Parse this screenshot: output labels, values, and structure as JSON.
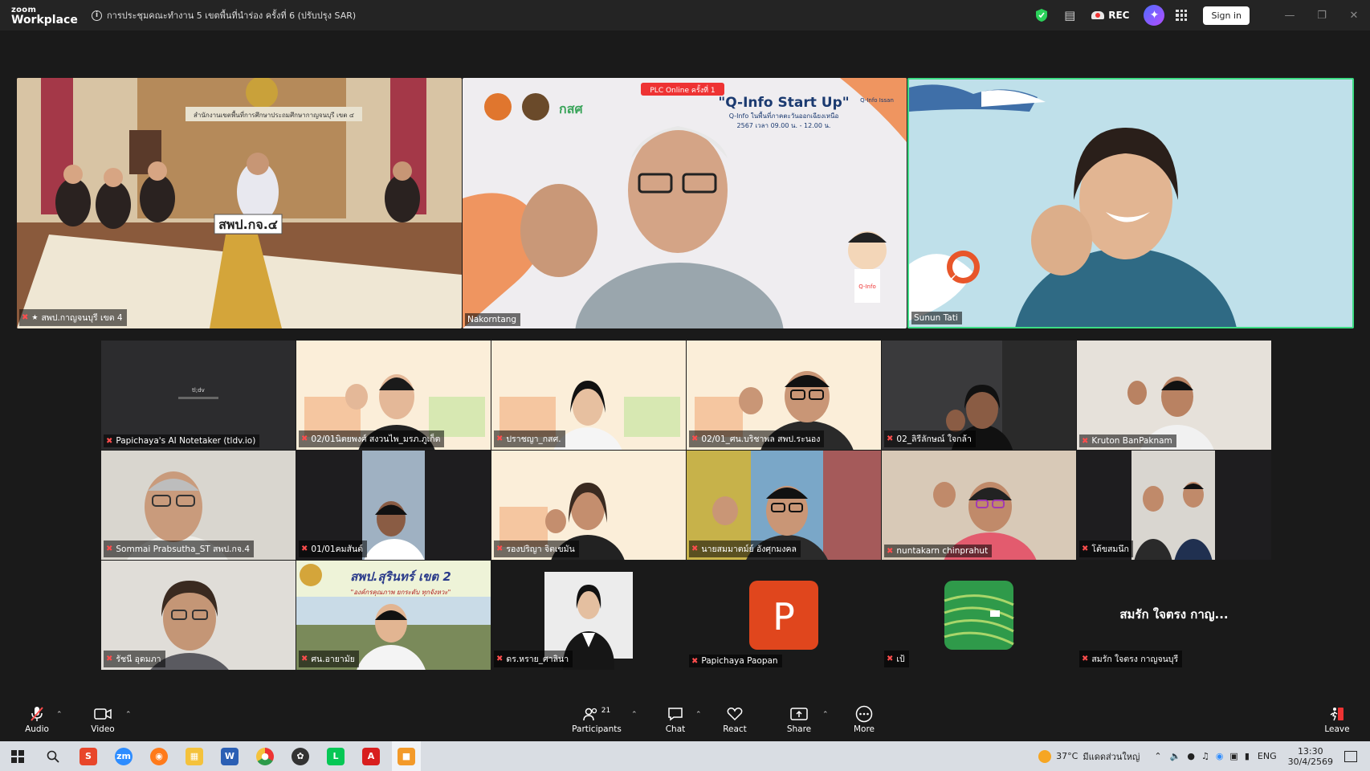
{
  "app": {
    "logo_line1": "zoom",
    "logo_line2": "Workplace",
    "meeting_title": "การประชุมคณะทำงาน 5 เขตพื้นที่นำร่อง ครั้งที่ 6 (ปรับปรุง SAR)",
    "rec_label": "REC",
    "sign_in_label": "Sign in"
  },
  "featured": [
    {
      "name": "สพป.กาญจนบุรี เขต 4",
      "sign": "สพป.กจ.๔",
      "banner": "สำนักงานเขตพื้นที่การศึกษาประถมศึกษากาญจนบุรี เขต ๔"
    },
    {
      "name": "Nakorntang",
      "slide_title": "\"Q-Info Start Up\"",
      "slide_sub": "Q-Info ในพื้นที่ภาคตะวันออกเฉียงเหนือ",
      "slide_time": "2567 เวลา 09.00 น. - 12.00 น.",
      "badge": "PLC Online ครั้งที่ 1",
      "brand": "กสศ",
      "qinfo_logo": "Q-Info Issan",
      "mascot_label": "Q-Info"
    },
    {
      "name": "Sunun Tati",
      "logo_letter": "Q"
    }
  ],
  "grid": [
    {
      "name": "Papichaya's AI Notetaker (tldv.io)",
      "logo": "tl;dv"
    },
    {
      "name": "02/01นิตยพงศ์ สงวนไพ_มรภ.ภูเก็ต"
    },
    {
      "name": "ปราชญา_กสศ."
    },
    {
      "name": "02/01_ศน.บริชาพล สพป.ระนอง"
    },
    {
      "name": "02_ลิรีลักษณ์ ใจกล้า"
    },
    {
      "name": "Kruton BanPaknam"
    },
    {
      "name": "Sommai Prabsutha_ST สพป.กจ.4"
    },
    {
      "name": "01/01คมสันต์"
    },
    {
      "name": "รองปริญา จิตเขมัน"
    },
    {
      "name": "นายสมมาตม์ย์ อังศุกมงคล"
    },
    {
      "name": "nuntakarn chinprahut"
    },
    {
      "name": "โต้ขสมนึก"
    },
    {
      "name": "รัชนี อุดมภา"
    },
    {
      "name": "ศน.อายามัย",
      "banner": "สพป.สุรินทร์ เขต 2",
      "banner_sub": "\"องค์กรคุณภาพ ยกระดับ ทุกจังหวะ\""
    },
    {
      "name": "ดร.หราย_ศาลินา"
    },
    {
      "name": "Papichaya Paopan",
      "avatar_letter": "P"
    },
    {
      "name": "เป้"
    },
    {
      "name": "สมรัก ใจตรง กาญจนบุรี",
      "display": "สมรัก ใจตรง กาญ..."
    }
  ],
  "toolbar": {
    "audio": "Audio",
    "video": "Video",
    "participants": "Participants",
    "participants_count": "21",
    "chat": "Chat",
    "react": "React",
    "share": "Share",
    "more": "More",
    "leave": "Leave"
  },
  "taskbar": {
    "temp": "37°C",
    "weather": "มีแดดส่วนใหญ่",
    "lang": "ENG",
    "time": "13:30",
    "date": "30/4/2569"
  }
}
